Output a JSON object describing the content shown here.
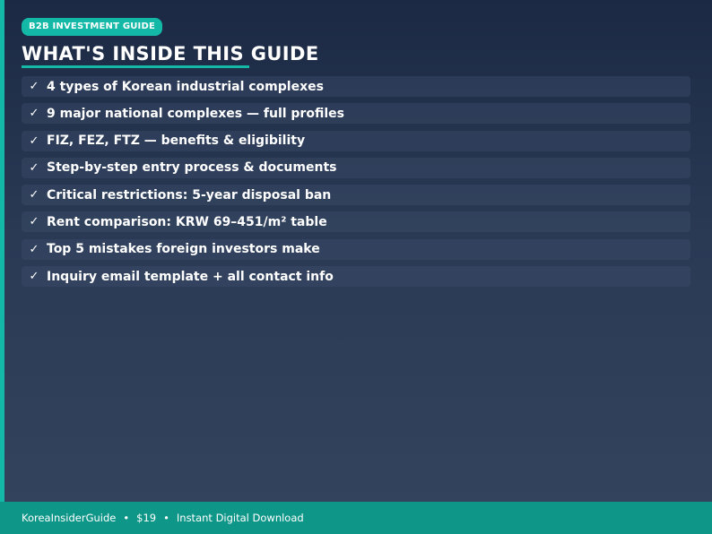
{
  "header": {
    "badge": "B2B INVESTMENT GUIDE",
    "title": "WHAT'S INSIDE THIS GUIDE"
  },
  "features": {
    "check_glyph": "✓",
    "items": [
      "4 types of Korean industrial complexes",
      "9 major national complexes — full profiles",
      "FIZ, FEZ, FTZ — benefits & eligibility",
      "Step-by-step entry process & documents",
      "Critical restrictions: 5-year disposal ban",
      "Rent comparison: KRW 69–451/m² table",
      "Top 5 mistakes foreign investors make",
      "Inquiry email template + all contact info"
    ]
  },
  "footer": {
    "brand": "KoreaInsiderGuide",
    "separator": "•",
    "price": "$19",
    "delivery": "Instant Digital Download"
  },
  "colors": {
    "accent": "#14b8a6",
    "footer": "#0e9688",
    "background_top": "#1b2944",
    "background_bottom": "#34445e"
  }
}
